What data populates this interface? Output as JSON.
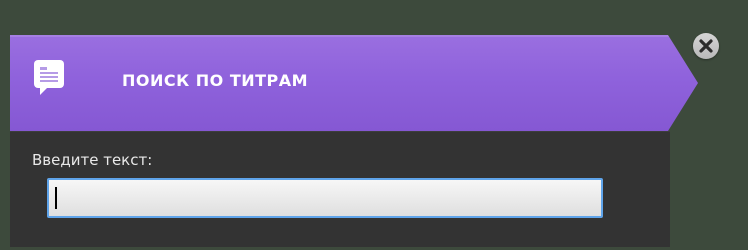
{
  "dialog": {
    "title": "ПОИСК ПО ТИТРАМ",
    "input_label": "Введите текст:",
    "input_value": "",
    "close_icon": "close-icon",
    "header_icon": "subtitle-icon"
  },
  "colors": {
    "header": "#8f62dc",
    "body": "#333333",
    "background": "#3d4a3c",
    "input_border": "#5fa4ea",
    "close_button": "#c8c8c8"
  }
}
